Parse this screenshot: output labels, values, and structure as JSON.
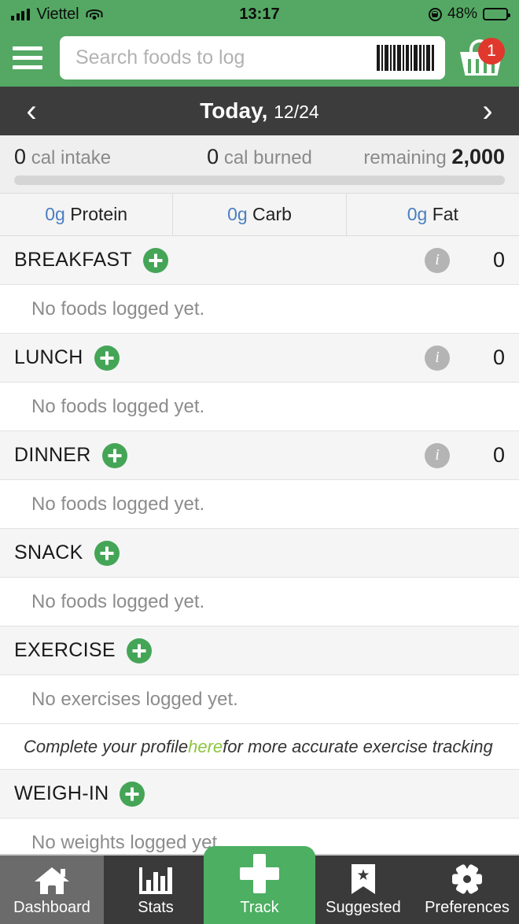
{
  "statusbar": {
    "carrier": "Viettel",
    "time": "13:17",
    "battery_percent": "48%",
    "signal_icon": "signal-bars-icon",
    "wifi_icon": "wifi-icon",
    "rotation_lock_icon": "rotation-lock-icon",
    "battery_icon": "battery-icon"
  },
  "header": {
    "menu_icon": "hamburger-menu-icon",
    "search_placeholder": "Search foods to log",
    "search_value": "",
    "barcode_icon": "barcode-scan-icon",
    "basket_icon": "shopping-basket-icon",
    "basket_badge": "1",
    "background_color": "#54a863"
  },
  "datebar": {
    "prev_icon": "chevron-left-icon",
    "next_icon": "chevron-right-icon",
    "label": "Today,",
    "date": "12/24",
    "background_color": "#3c3c3c"
  },
  "summary": {
    "intake_value": "0",
    "intake_label": "cal intake",
    "burned_value": "0",
    "burned_label": "cal burned",
    "remaining_label": "remaining",
    "remaining_value": "2,000",
    "progress_percent": "0",
    "macros": [
      {
        "value": "0g",
        "label": "Protein"
      },
      {
        "value": "0g",
        "label": "Carb"
      },
      {
        "value": "0g",
        "label": "Fat"
      }
    ],
    "macro_value_color": "#4a7fc1"
  },
  "sections": [
    {
      "title": "BREAKFAST",
      "empty_text": "No foods logged yet.",
      "calories": "0",
      "has_info": true
    },
    {
      "title": "LUNCH",
      "empty_text": "No foods logged yet.",
      "calories": "0",
      "has_info": true
    },
    {
      "title": "DINNER",
      "empty_text": "No foods logged yet.",
      "calories": "0",
      "has_info": true
    },
    {
      "title": "SNACK",
      "empty_text": "No foods logged yet.",
      "calories": "",
      "has_info": false
    },
    {
      "title": "EXERCISE",
      "empty_text": "No exercises logged yet.",
      "calories": "",
      "has_info": false
    },
    {
      "title": "WEIGH-IN",
      "empty_text": "No weights logged yet.",
      "calories": "",
      "has_info": false
    }
  ],
  "exercise_note": {
    "prefix": "Complete your profile ",
    "link": "here",
    "suffix": " for more accurate exercise tracking",
    "link_color": "#8cc63f"
  },
  "navbar": {
    "items": [
      {
        "label": "Dashboard",
        "icon": "home-icon",
        "active": true
      },
      {
        "label": "Stats",
        "icon": "bar-chart-icon",
        "active": false
      },
      {
        "label": "Suggested",
        "icon": "bookmark-star-icon",
        "active": false
      },
      {
        "label": "Preferences",
        "icon": "gear-icon",
        "active": false
      }
    ],
    "track": {
      "label": "Track",
      "icon": "plus-icon",
      "color": "#4caf62"
    }
  }
}
